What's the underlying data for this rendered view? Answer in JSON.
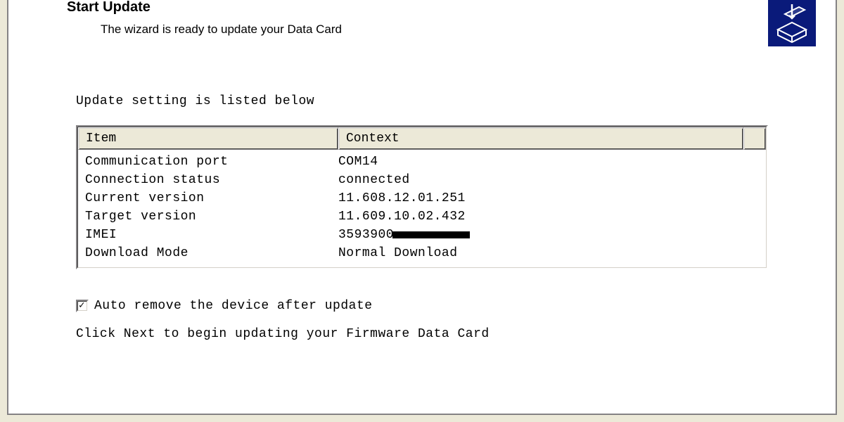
{
  "header": {
    "title": "Start Update",
    "subtitle": "The wizard is ready to update your Data Card"
  },
  "settings": {
    "label": "Update setting is listed below",
    "columns": {
      "item": "Item",
      "context": "Context"
    },
    "rows": [
      {
        "item": "Communication port",
        "context": "COM14"
      },
      {
        "item": "Connection status",
        "context": "connected"
      },
      {
        "item": "Current version",
        "context": "11.608.12.01.251"
      },
      {
        "item": "Target version",
        "context": "11.609.10.02.432"
      },
      {
        "item": "IMEI",
        "context": "3593900",
        "redacted": true
      },
      {
        "item": "Download Mode",
        "context": "Normal Download"
      }
    ]
  },
  "footer": {
    "checkbox_label": "Auto remove the device after update",
    "checkbox_checked": true,
    "instruction": "Click Next to begin updating your Firmware Data Card"
  }
}
